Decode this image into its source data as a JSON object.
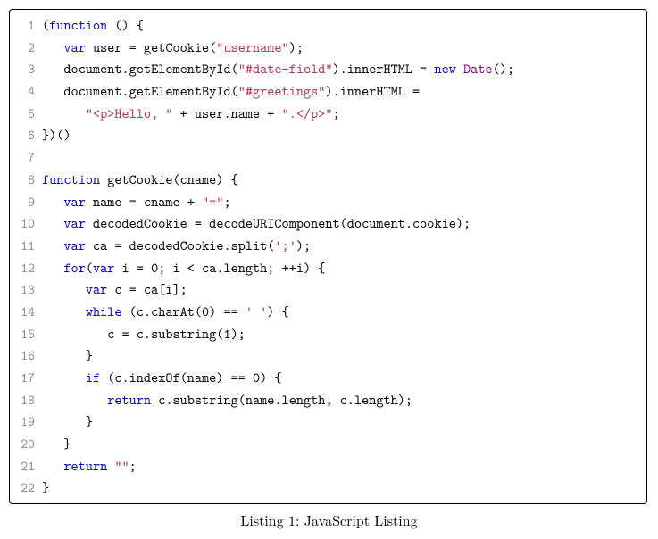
{
  "caption": "Listing 1: JavaScript Listing",
  "lineNumbers": [
    "1",
    "2",
    "3",
    "4",
    "5",
    "6",
    "7",
    "8",
    "9",
    "10",
    "11",
    "12",
    "13",
    "14",
    "15",
    "16",
    "17",
    "18",
    "19",
    "20",
    "21",
    "22"
  ],
  "code": [
    {
      "tokens": [
        [
          "(",
          ""
        ],
        [
          "function",
          "kw"
        ],
        [
          " () {",
          ""
        ]
      ]
    },
    {
      "tokens": [
        [
          "   ",
          ""
        ],
        [
          "var",
          "kw"
        ],
        [
          " user = getCookie(",
          ""
        ],
        [
          "\"username\"",
          "str"
        ],
        [
          ");",
          ""
        ]
      ]
    },
    {
      "tokens": [
        [
          "   document.getElementById(",
          ""
        ],
        [
          "\"#date-field\"",
          "str"
        ],
        [
          ").innerHTML = ",
          ""
        ],
        [
          "new",
          "kw"
        ],
        [
          " ",
          ""
        ],
        [
          "Date",
          "nw"
        ],
        [
          "();",
          ""
        ]
      ]
    },
    {
      "tokens": [
        [
          "   document.getElementById(",
          ""
        ],
        [
          "\"#greetings\"",
          "str"
        ],
        [
          ").innerHTML =",
          ""
        ]
      ]
    },
    {
      "tokens": [
        [
          "      ",
          ""
        ],
        [
          "\"<p>Hello, \"",
          "str"
        ],
        [
          " + user.name + ",
          ""
        ],
        [
          "\".</p>\"",
          "str"
        ],
        [
          ";",
          ""
        ]
      ]
    },
    {
      "tokens": [
        [
          "})()",
          ""
        ]
      ]
    },
    {
      "tokens": [
        [
          "",
          ""
        ]
      ]
    },
    {
      "tokens": [
        [
          "function",
          "kw"
        ],
        [
          " getCookie(cname) {",
          ""
        ]
      ]
    },
    {
      "tokens": [
        [
          "   ",
          ""
        ],
        [
          "var",
          "kw"
        ],
        [
          " name = cname + ",
          ""
        ],
        [
          "\"=\"",
          "str"
        ],
        [
          ";",
          ""
        ]
      ]
    },
    {
      "tokens": [
        [
          "   ",
          ""
        ],
        [
          "var",
          "kw"
        ],
        [
          " decodedCookie = decodeURIComponent(document.cookie);",
          ""
        ]
      ]
    },
    {
      "tokens": [
        [
          "   ",
          ""
        ],
        [
          "var",
          "kw"
        ],
        [
          " ca = decodedCookie.split(",
          ""
        ],
        [
          "';'",
          "str"
        ],
        [
          ");",
          ""
        ]
      ]
    },
    {
      "tokens": [
        [
          "   ",
          ""
        ],
        [
          "for",
          "kw"
        ],
        [
          "(",
          ""
        ],
        [
          "var",
          "kw"
        ],
        [
          " i = 0; i < ca.length; ++i) {",
          ""
        ]
      ]
    },
    {
      "tokens": [
        [
          "      ",
          ""
        ],
        [
          "var",
          "kw"
        ],
        [
          " c = ca[i];",
          ""
        ]
      ]
    },
    {
      "tokens": [
        [
          "      ",
          ""
        ],
        [
          "while",
          "kw"
        ],
        [
          " (c.charAt(0) == ",
          ""
        ],
        [
          "' '",
          "str"
        ],
        [
          ") {",
          ""
        ]
      ]
    },
    {
      "tokens": [
        [
          "         c = c.substring(1);",
          ""
        ]
      ]
    },
    {
      "tokens": [
        [
          "      }",
          ""
        ]
      ]
    },
    {
      "tokens": [
        [
          "      ",
          ""
        ],
        [
          "if",
          "kw"
        ],
        [
          " (c.indexOf(name) == 0) {",
          ""
        ]
      ]
    },
    {
      "tokens": [
        [
          "         ",
          ""
        ],
        [
          "return",
          "kw"
        ],
        [
          " c.substring(name.length, c.length);",
          ""
        ]
      ]
    },
    {
      "tokens": [
        [
          "      }",
          ""
        ]
      ]
    },
    {
      "tokens": [
        [
          "   }",
          ""
        ]
      ]
    },
    {
      "tokens": [
        [
          "   ",
          ""
        ],
        [
          "return",
          "kw"
        ],
        [
          " ",
          ""
        ],
        [
          "\"\"",
          "str"
        ],
        [
          ";",
          ""
        ]
      ]
    },
    {
      "tokens": [
        [
          "}",
          ""
        ]
      ]
    }
  ]
}
